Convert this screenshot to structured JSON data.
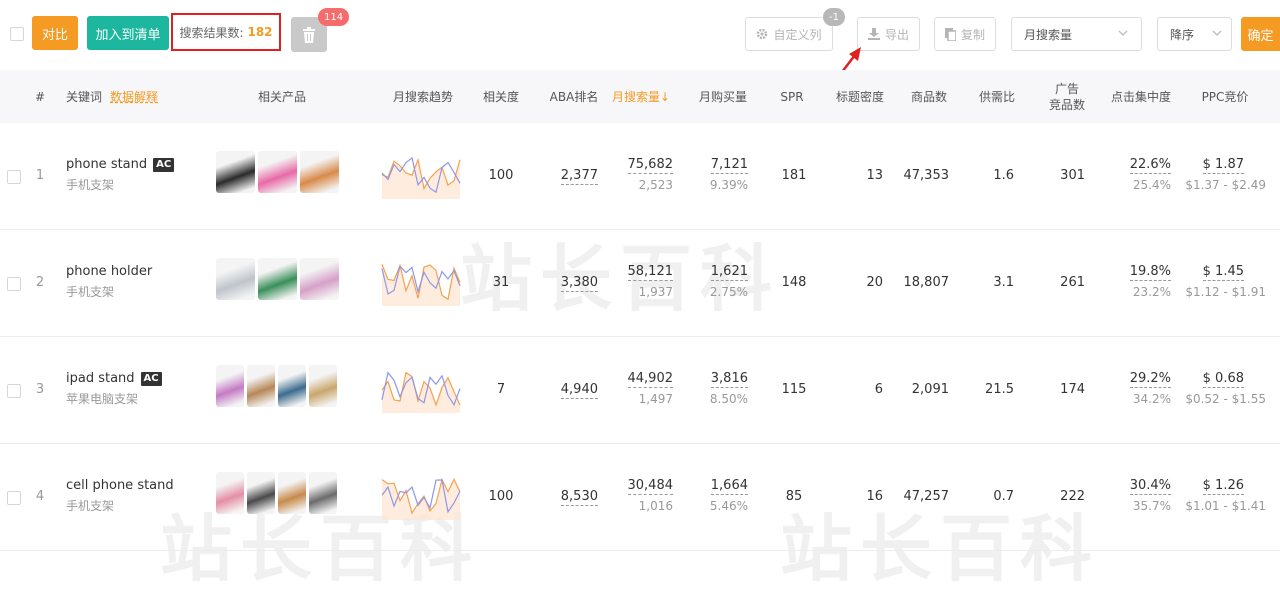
{
  "toolbar": {
    "compare_label": "对比",
    "add_to_list_label": "加入到清单",
    "result_label": "搜索结果数:",
    "result_count": "182",
    "trash_badge": "114",
    "custom_cols_label": "自定义列",
    "custom_cols_badge": "-1",
    "export_label": "导出",
    "copy_label": "复制",
    "sort_field": "月搜索量",
    "sort_order": "降序",
    "confirm_label": "确定"
  },
  "columns": {
    "index": "#",
    "keyword": "关键词",
    "data_explain": "数据解释",
    "products": "相关产品",
    "trend": "月搜索趋势",
    "relevance": "相关度",
    "aba_rank": "ABA排名",
    "monthly_search": "月搜索量↓",
    "monthly_purchase": "月购买量",
    "spr": "SPR",
    "title_density": "标题密度",
    "product_count": "商品数",
    "supply_demand": "供需比",
    "ad_products_line1": "广告",
    "ad_products_line2": "竞品数",
    "click_concentration": "点击集中度",
    "ppc_bid": "PPC竞价"
  },
  "rows": [
    {
      "index": "1",
      "keyword": "phone stand",
      "ac": "AC",
      "translation": "手机支架",
      "relevance": "100",
      "aba": "2,377",
      "search": "75,682",
      "search_sub": "2,523",
      "purchase": "7,121",
      "purchase_rate": "9.39%",
      "spr": "181",
      "density": "13",
      "products": "47,353",
      "sd": "1.6",
      "ads": "301",
      "click": "22.6%",
      "click_sub": "25.4%",
      "ppc": "$ 1.87",
      "ppc_range": "$1.37 - $2.49"
    },
    {
      "index": "2",
      "keyword": "phone holder",
      "ac": "",
      "translation": "手机支架",
      "relevance": "31",
      "aba": "3,380",
      "search": "58,121",
      "search_sub": "1,937",
      "purchase": "1,621",
      "purchase_rate": "2.75%",
      "spr": "148",
      "density": "20",
      "products": "18,807",
      "sd": "3.1",
      "ads": "261",
      "click": "19.8%",
      "click_sub": "23.2%",
      "ppc": "$ 1.45",
      "ppc_range": "$1.12 - $1.91"
    },
    {
      "index": "3",
      "keyword": "ipad stand",
      "ac": "AC",
      "translation": "苹果电脑支架",
      "relevance": "7",
      "aba": "4,940",
      "search": "44,902",
      "search_sub": "1,497",
      "purchase": "3,816",
      "purchase_rate": "8.50%",
      "spr": "115",
      "density": "6",
      "products": "2,091",
      "sd": "21.5",
      "ads": "174",
      "click": "29.2%",
      "click_sub": "34.2%",
      "ppc": "$ 0.68",
      "ppc_range": "$0.52 - $1.55"
    },
    {
      "index": "4",
      "keyword": "cell phone stand",
      "ac": "",
      "translation": "手机支架",
      "relevance": "100",
      "aba": "8,530",
      "search": "30,484",
      "search_sub": "1,016",
      "purchase": "1,664",
      "purchase_rate": "5.46%",
      "spr": "85",
      "density": "16",
      "products": "47,257",
      "sd": "0.7",
      "ads": "222",
      "click": "30.4%",
      "click_sub": "35.7%",
      "ppc": "$ 1.26",
      "ppc_range": "$1.01 - $1.41"
    }
  ],
  "colors": {
    "orange": "#f59a23",
    "green": "#1cb79e",
    "red": "#e02020",
    "trend_orange": "#f6a04d",
    "trend_blue": "#8f96e8"
  },
  "watermark": "站长百科"
}
